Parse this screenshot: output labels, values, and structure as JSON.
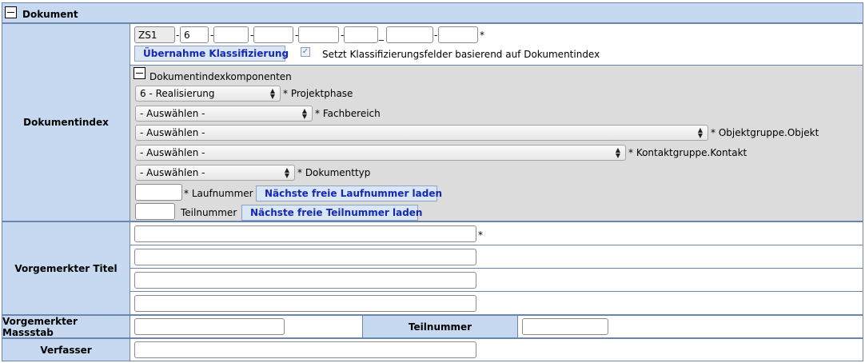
{
  "section": {
    "title": "Dokument"
  },
  "labels": {
    "dokumentindex": "Dokumentindex",
    "titel": "Vorgemerkter Titel",
    "massstab": "Vorgemerkter Massstab",
    "teilnummer": "Teilnummer",
    "verfasser": "Verfasser"
  },
  "index_fields": {
    "prefix": "ZS1",
    "phase_value": "6",
    "sep": "-",
    "underscore": "_",
    "required": "*"
  },
  "classification": {
    "button_label": "Übernahme Klassifizierung",
    "checkbox_label": "Setzt Klassifizierungsfelder basierend auf Dokumentindex",
    "checkbox_checked": true
  },
  "components": {
    "title": "Dokumentindexkomponenten",
    "projektphase": {
      "value": "6 - Realisierung",
      "label": "* Projektphase"
    },
    "fachbereich": {
      "value": "- Auswählen -",
      "label": "* Fachbereich"
    },
    "objekt": {
      "value": "- Auswählen -",
      "label": "* Objektgruppe.Objekt"
    },
    "kontakt": {
      "value": "- Auswählen -",
      "label": "* Kontaktgruppe.Kontakt"
    },
    "dokumenttyp": {
      "value": "- Auswählen -",
      "label": "* Dokumenttyp"
    },
    "laufnummer": {
      "label": "* Laufnummer",
      "button": "Nächste freie Laufnummer laden"
    },
    "teilnummer": {
      "label": "Teilnummer",
      "button": "Nächste freie Teilnummer laden"
    }
  },
  "colors": {
    "label_bg": "#c6d9f1",
    "border": "#6a86ad",
    "components_bg": "#dcdcdc",
    "button_text": "#1428b4"
  }
}
